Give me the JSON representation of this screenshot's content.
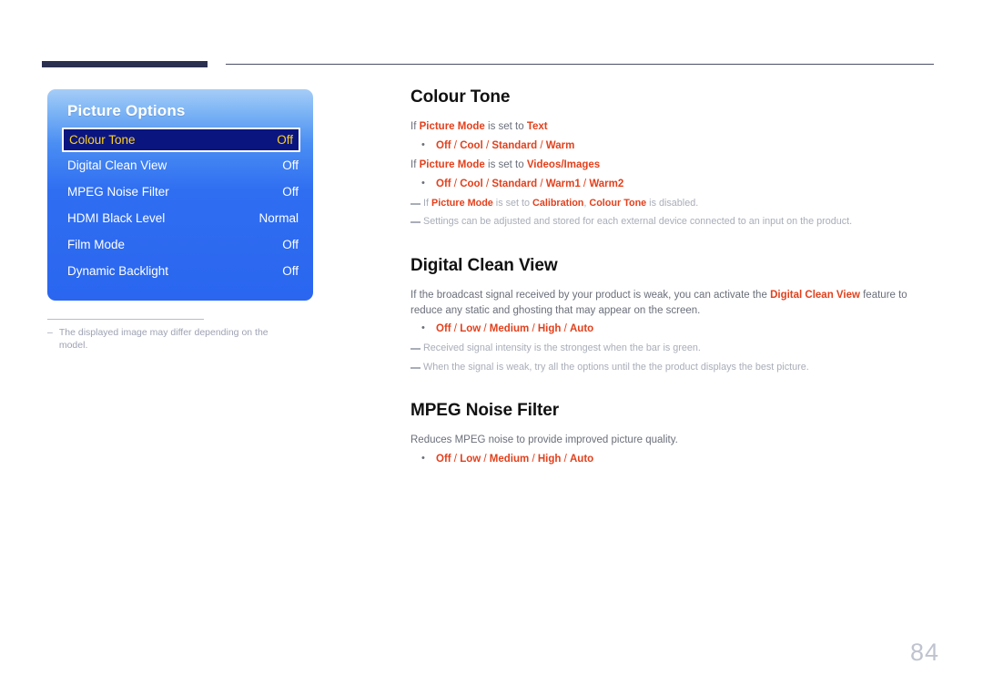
{
  "page": {
    "number": "84"
  },
  "osd": {
    "title": "Picture Options",
    "rows": [
      {
        "label": "Colour Tone",
        "value": "Off",
        "selected": true
      },
      {
        "label": "Digital Clean View",
        "value": "Off",
        "selected": false
      },
      {
        "label": "MPEG Noise Filter",
        "value": "Off",
        "selected": false
      },
      {
        "label": "HDMI Black Level",
        "value": "Normal",
        "selected": false
      },
      {
        "label": "Film Mode",
        "value": "Off",
        "selected": false
      },
      {
        "label": "Dynamic Backlight",
        "value": "Off",
        "selected": false
      }
    ],
    "caption": {
      "dash": "–",
      "text": "The displayed image may differ depending on the model."
    },
    "colors": {
      "panel_top": "#a6cdf7",
      "panel_bottom": "#2a66f0",
      "selected_bg": "#0a1580",
      "selected_text": "#ffd21e"
    }
  },
  "sections": [
    {
      "heading": "Colour Tone",
      "cond1": {
        "pre": "If ",
        "term": "Picture Mode",
        "mid": " is set to ",
        "value": "Text"
      },
      "bullet1": {
        "items": [
          "Off",
          "Cool",
          "Standard",
          "Warm"
        ],
        "separator": " / ",
        "dot": "•"
      },
      "cond2": {
        "pre": "If ",
        "term": "Picture Mode",
        "mid": " is set to ",
        "value": "Videos/Images"
      },
      "bullet2": {
        "items": [
          "Off",
          "Cool",
          "Standard",
          "Warm1",
          "Warm2"
        ],
        "separator": " / ",
        "dot": "•"
      },
      "note1": {
        "pre": "If ",
        "term1": "Picture Mode",
        "mid1": " is set to ",
        "term2": "Calibration",
        "mid2": ", ",
        "term3": "Colour Tone",
        "tail": " is disabled."
      },
      "note2": "Settings can be adjusted and stored for each external device connected to an input on the product."
    },
    {
      "heading": "Digital Clean View",
      "para": {
        "pre": "If the broadcast signal received by your product is weak, you can activate the ",
        "term": "Digital Clean View",
        "tail": " feature to reduce any static and ghosting that may appear on the screen."
      },
      "bullet": {
        "items": [
          "Off",
          "Low",
          "Medium",
          "High",
          "Auto"
        ],
        "separator": " / ",
        "dot": "•"
      },
      "note1": "Received signal intensity is the strongest when the bar is green.",
      "note2": "When the signal is weak, try all the options until the the product displays the best picture."
    },
    {
      "heading": "MPEG Noise Filter",
      "para": "Reduces MPEG noise to provide improved picture quality.",
      "bullet": {
        "items": [
          "Off",
          "Low",
          "Medium",
          "High",
          "Auto"
        ],
        "separator": " / ",
        "dot": "•"
      }
    }
  ],
  "theme": {
    "accent": "#e3401c",
    "rule_dark": "#2b3050",
    "body_text": "#6b6f7a",
    "note_text": "#a9adb8"
  }
}
